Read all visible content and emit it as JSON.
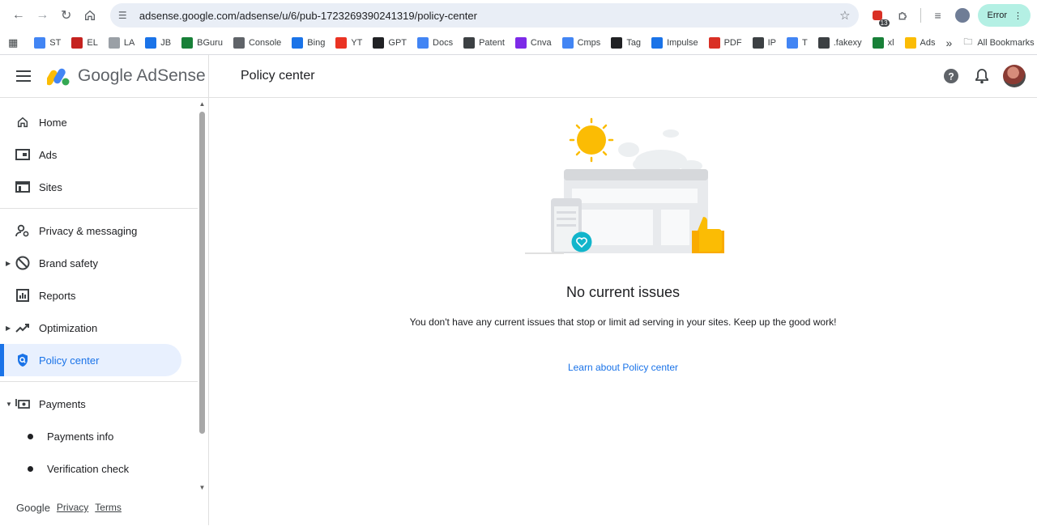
{
  "browser": {
    "url": "adsense.google.com/adsense/u/6/pub-1723269390241319/policy-center",
    "ext_badge": "13",
    "error_label": "Error",
    "bookmarks": [
      {
        "label": "ST",
        "color": "#4285f4"
      },
      {
        "label": "EL",
        "color": "#c5221f"
      },
      {
        "label": "LA",
        "color": "#9aa0a6"
      },
      {
        "label": "JB",
        "color": "#1a73e8"
      },
      {
        "label": "BGuru",
        "color": "#188038"
      },
      {
        "label": "Console",
        "color": "#5f6368"
      },
      {
        "label": "Bing",
        "color": "#1a73e8"
      },
      {
        "label": "YT",
        "color": "#ea3323"
      },
      {
        "label": "GPT",
        "color": "#202124"
      },
      {
        "label": "Docs",
        "color": "#4285f4"
      },
      {
        "label": "Patent",
        "color": "#3c4043"
      },
      {
        "label": "Cnva",
        "color": "#7d2ae8"
      },
      {
        "label": "Cmps",
        "color": "#4285f4"
      },
      {
        "label": "Tag",
        "color": "#202124"
      },
      {
        "label": "Impulse",
        "color": "#1a73e8"
      },
      {
        "label": "PDF",
        "color": "#d93025"
      },
      {
        "label": "IP",
        "color": "#3c4043"
      },
      {
        "label": "T",
        "color": "#4285f4"
      },
      {
        "label": ".fakexy",
        "color": "#3c4043"
      },
      {
        "label": "xl",
        "color": "#188038"
      },
      {
        "label": "Ads",
        "color": "#fbbc04"
      }
    ],
    "more_label": "»",
    "all_bookmarks": "All Bookmarks"
  },
  "header": {
    "logo_text": "Google AdSense",
    "page_title": "Policy center"
  },
  "sidebar": {
    "items": [
      {
        "label": "Home",
        "icon": "home-icon"
      },
      {
        "label": "Ads",
        "icon": "ads-icon"
      },
      {
        "label": "Sites",
        "icon": "sites-icon"
      },
      {
        "label": "Privacy & messaging",
        "icon": "privacy-icon"
      },
      {
        "label": "Brand safety",
        "icon": "block-icon"
      },
      {
        "label": "Reports",
        "icon": "reports-icon"
      },
      {
        "label": "Optimization",
        "icon": "trending-icon"
      },
      {
        "label": "Policy center",
        "icon": "policy-shield-icon"
      },
      {
        "label": "Payments",
        "icon": "payments-icon"
      }
    ],
    "sub_items": [
      {
        "label": "Payments info"
      },
      {
        "label": "Verification check"
      }
    ],
    "footer": {
      "google": "Google",
      "privacy": "Privacy",
      "terms": "Terms"
    }
  },
  "main": {
    "title": "No current issues",
    "description": "You don't have any current issues that stop or limit ad serving in your sites. Keep up the good work!",
    "link": "Learn about Policy center"
  },
  "colors": {
    "accent": "#1a73e8",
    "active_bg": "#e8f0fe",
    "sun": "#fbbc04",
    "teal": "#12b5cb"
  }
}
